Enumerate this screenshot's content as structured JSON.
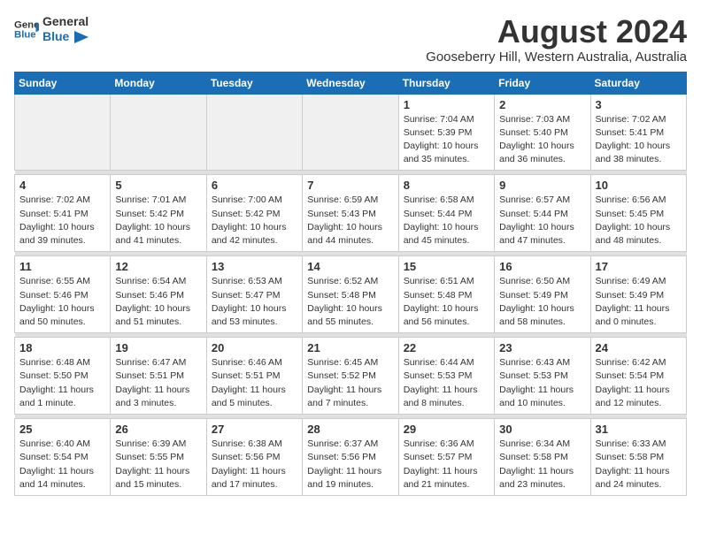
{
  "header": {
    "logo_line1": "General",
    "logo_line2": "Blue",
    "month": "August 2024",
    "location": "Gooseberry Hill, Western Australia, Australia"
  },
  "weekdays": [
    "Sunday",
    "Monday",
    "Tuesday",
    "Wednesday",
    "Thursday",
    "Friday",
    "Saturday"
  ],
  "weeks": [
    [
      {
        "day": "",
        "info": ""
      },
      {
        "day": "",
        "info": ""
      },
      {
        "day": "",
        "info": ""
      },
      {
        "day": "",
        "info": ""
      },
      {
        "day": "1",
        "info": "Sunrise: 7:04 AM\nSunset: 5:39 PM\nDaylight: 10 hours\nand 35 minutes."
      },
      {
        "day": "2",
        "info": "Sunrise: 7:03 AM\nSunset: 5:40 PM\nDaylight: 10 hours\nand 36 minutes."
      },
      {
        "day": "3",
        "info": "Sunrise: 7:02 AM\nSunset: 5:41 PM\nDaylight: 10 hours\nand 38 minutes."
      }
    ],
    [
      {
        "day": "4",
        "info": "Sunrise: 7:02 AM\nSunset: 5:41 PM\nDaylight: 10 hours\nand 39 minutes."
      },
      {
        "day": "5",
        "info": "Sunrise: 7:01 AM\nSunset: 5:42 PM\nDaylight: 10 hours\nand 41 minutes."
      },
      {
        "day": "6",
        "info": "Sunrise: 7:00 AM\nSunset: 5:42 PM\nDaylight: 10 hours\nand 42 minutes."
      },
      {
        "day": "7",
        "info": "Sunrise: 6:59 AM\nSunset: 5:43 PM\nDaylight: 10 hours\nand 44 minutes."
      },
      {
        "day": "8",
        "info": "Sunrise: 6:58 AM\nSunset: 5:44 PM\nDaylight: 10 hours\nand 45 minutes."
      },
      {
        "day": "9",
        "info": "Sunrise: 6:57 AM\nSunset: 5:44 PM\nDaylight: 10 hours\nand 47 minutes."
      },
      {
        "day": "10",
        "info": "Sunrise: 6:56 AM\nSunset: 5:45 PM\nDaylight: 10 hours\nand 48 minutes."
      }
    ],
    [
      {
        "day": "11",
        "info": "Sunrise: 6:55 AM\nSunset: 5:46 PM\nDaylight: 10 hours\nand 50 minutes."
      },
      {
        "day": "12",
        "info": "Sunrise: 6:54 AM\nSunset: 5:46 PM\nDaylight: 10 hours\nand 51 minutes."
      },
      {
        "day": "13",
        "info": "Sunrise: 6:53 AM\nSunset: 5:47 PM\nDaylight: 10 hours\nand 53 minutes."
      },
      {
        "day": "14",
        "info": "Sunrise: 6:52 AM\nSunset: 5:48 PM\nDaylight: 10 hours\nand 55 minutes."
      },
      {
        "day": "15",
        "info": "Sunrise: 6:51 AM\nSunset: 5:48 PM\nDaylight: 10 hours\nand 56 minutes."
      },
      {
        "day": "16",
        "info": "Sunrise: 6:50 AM\nSunset: 5:49 PM\nDaylight: 10 hours\nand 58 minutes."
      },
      {
        "day": "17",
        "info": "Sunrise: 6:49 AM\nSunset: 5:49 PM\nDaylight: 11 hours\nand 0 minutes."
      }
    ],
    [
      {
        "day": "18",
        "info": "Sunrise: 6:48 AM\nSunset: 5:50 PM\nDaylight: 11 hours\nand 1 minute."
      },
      {
        "day": "19",
        "info": "Sunrise: 6:47 AM\nSunset: 5:51 PM\nDaylight: 11 hours\nand 3 minutes."
      },
      {
        "day": "20",
        "info": "Sunrise: 6:46 AM\nSunset: 5:51 PM\nDaylight: 11 hours\nand 5 minutes."
      },
      {
        "day": "21",
        "info": "Sunrise: 6:45 AM\nSunset: 5:52 PM\nDaylight: 11 hours\nand 7 minutes."
      },
      {
        "day": "22",
        "info": "Sunrise: 6:44 AM\nSunset: 5:53 PM\nDaylight: 11 hours\nand 8 minutes."
      },
      {
        "day": "23",
        "info": "Sunrise: 6:43 AM\nSunset: 5:53 PM\nDaylight: 11 hours\nand 10 minutes."
      },
      {
        "day": "24",
        "info": "Sunrise: 6:42 AM\nSunset: 5:54 PM\nDaylight: 11 hours\nand 12 minutes."
      }
    ],
    [
      {
        "day": "25",
        "info": "Sunrise: 6:40 AM\nSunset: 5:54 PM\nDaylight: 11 hours\nand 14 minutes."
      },
      {
        "day": "26",
        "info": "Sunrise: 6:39 AM\nSunset: 5:55 PM\nDaylight: 11 hours\nand 15 minutes."
      },
      {
        "day": "27",
        "info": "Sunrise: 6:38 AM\nSunset: 5:56 PM\nDaylight: 11 hours\nand 17 minutes."
      },
      {
        "day": "28",
        "info": "Sunrise: 6:37 AM\nSunset: 5:56 PM\nDaylight: 11 hours\nand 19 minutes."
      },
      {
        "day": "29",
        "info": "Sunrise: 6:36 AM\nSunset: 5:57 PM\nDaylight: 11 hours\nand 21 minutes."
      },
      {
        "day": "30",
        "info": "Sunrise: 6:34 AM\nSunset: 5:58 PM\nDaylight: 11 hours\nand 23 minutes."
      },
      {
        "day": "31",
        "info": "Sunrise: 6:33 AM\nSunset: 5:58 PM\nDaylight: 11 hours\nand 24 minutes."
      }
    ]
  ]
}
